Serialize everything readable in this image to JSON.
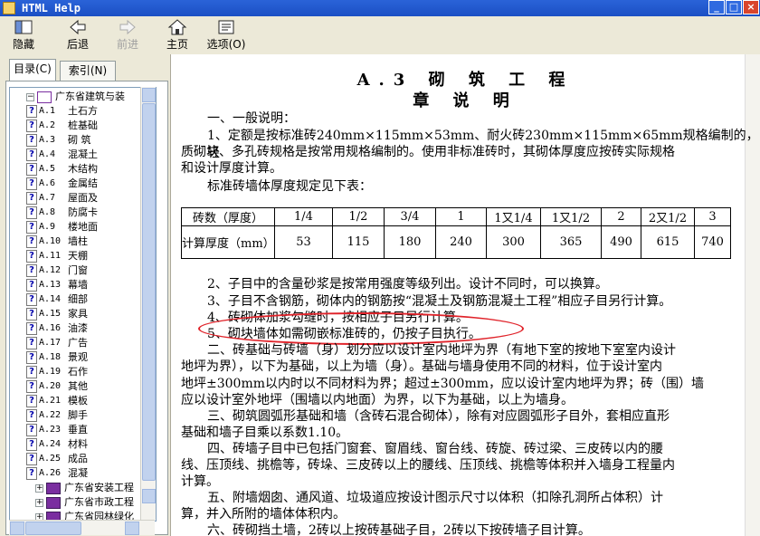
{
  "window": {
    "title": "HTML Help",
    "controls": [
      "_",
      "□",
      "×"
    ]
  },
  "toolbar": {
    "hide": "隐藏",
    "back": "后退",
    "forward": "前进",
    "home": "主页",
    "options": "选项(O)"
  },
  "tabs": {
    "contents": "目录(C)",
    "index": "索引(N)"
  },
  "tree": {
    "root": "广东省建筑与装",
    "items": [
      {
        "code": "A.1",
        "label": "土石方"
      },
      {
        "code": "A.2",
        "label": "桩基础"
      },
      {
        "code": "A.3",
        "label": "砌 筑"
      },
      {
        "code": "A.4",
        "label": "混凝土"
      },
      {
        "code": "A.5",
        "label": "木结构"
      },
      {
        "code": "A.6",
        "label": "金属结"
      },
      {
        "code": "A.7",
        "label": "屋面及"
      },
      {
        "code": "A.8",
        "label": "防腐卡"
      },
      {
        "code": "A.9",
        "label": "楼地面"
      },
      {
        "code": "A.10",
        "label": "墙柱"
      },
      {
        "code": "A.11",
        "label": "天棚"
      },
      {
        "code": "A.12",
        "label": "门窗"
      },
      {
        "code": "A.13",
        "label": "幕墙"
      },
      {
        "code": "A.14",
        "label": "细部"
      },
      {
        "code": "A.15",
        "label": "家具"
      },
      {
        "code": "A.16",
        "label": "油漆"
      },
      {
        "code": "A.17",
        "label": "广告"
      },
      {
        "code": "A.18",
        "label": "景观"
      },
      {
        "code": "A.19",
        "label": "石作"
      },
      {
        "code": "A.20",
        "label": "其他"
      },
      {
        "code": "A.21",
        "label": "模板"
      },
      {
        "code": "A.22",
        "label": "脚手"
      },
      {
        "code": "A.23",
        "label": "垂直"
      },
      {
        "code": "A.24",
        "label": "材料"
      },
      {
        "code": "A.25",
        "label": "成品"
      },
      {
        "code": "A.26",
        "label": "混凝"
      }
    ],
    "books": [
      "广东省安装工程",
      "广东省市政工程",
      "广东省园林绿化"
    ]
  },
  "doc": {
    "title1": "A.3 砌 筑 工 程",
    "title2": "章 说 明",
    "s1": "一、一般说明：",
    "p1": "1、定额是按标准砖240mm×115mm×53mm、耐火砖230mm×115mm×65mm规格编制的，轻",
    "p1b": "质砌块、多孔砖规格是按常用规格编制的。使用非标准砖时，其砌体厚度应按砖实际规格",
    "p1c": "和设计厚度计算。",
    "p1d": "标准砖墙体厚度规定见下表：",
    "table": {
      "row1_label": "砖数（厚度）",
      "row2_label": "计算厚度（mm）",
      "thickness": [
        "1/4",
        "1/2",
        "3/4",
        "1",
        "1又1/4",
        "1又1/2",
        "2",
        "2又1/2",
        "3"
      ],
      "values": [
        "53",
        "115",
        "180",
        "240",
        "300",
        "365",
        "490",
        "615",
        "740"
      ]
    },
    "p2": "2、子目中的含量砂浆是按常用强度等级列出。设计不同时，可以换算。",
    "p3": "3、子目不含钢筋，砌体内的钢筋按“混凝土及钢筋混凝土工程”相应子目另行计算。",
    "p4": "4、砖砌体加浆勾缝时，按相应子目另行计算。",
    "p5": "5、砌块墙体如需砌嵌标准砖的，仍按子目执行。",
    "s2": "二、砖基础与砖墙（身）划分应以设计室内地坪为界（有地下室的按地下室室内设计",
    "s2b": "地坪为界），以下为基础，以上为墙（身）。基础与墙身使用不同的材料，位于设计室内",
    "s2c": "地坪±300mm以内时以不同材料为界；超过±300mm，应以设计室内地坪为界；砖（围）墙",
    "s2d": "应以设计室外地坪（围墙以内地面）为界，以下为基础，以上为墙身。",
    "s3": "三、砌筑圆弧形基础和墙（含砖石混合砌体），除有对应圆弧形子目外，套相应直形",
    "s3b": "基础和墙子目乘以系数1.10。",
    "s4": "四、砖墙子目中已包括门窗套、窗眉线、窗台线、砖旋、砖过梁、三皮砖以内的腰",
    "s4b": "线、压顶线、挑檐等，砖垛、三皮砖以上的腰线、压顶线、挑檐等体积并入墙身工程量内",
    "s4c": "计算。",
    "s5": "五、附墙烟囱、通风道、垃圾道应按设计图示尺寸以体积（扣除孔洞所占体积）计",
    "s5b": "算，并入所附的墙体体积内。",
    "s6": "六、砖砌挡土墙，2砖以上按砖基础子目，2砖以下按砖墙子目计算。"
  },
  "colors": {
    "titlebar": "#1b4fc4",
    "annotation": "#e0232a"
  }
}
